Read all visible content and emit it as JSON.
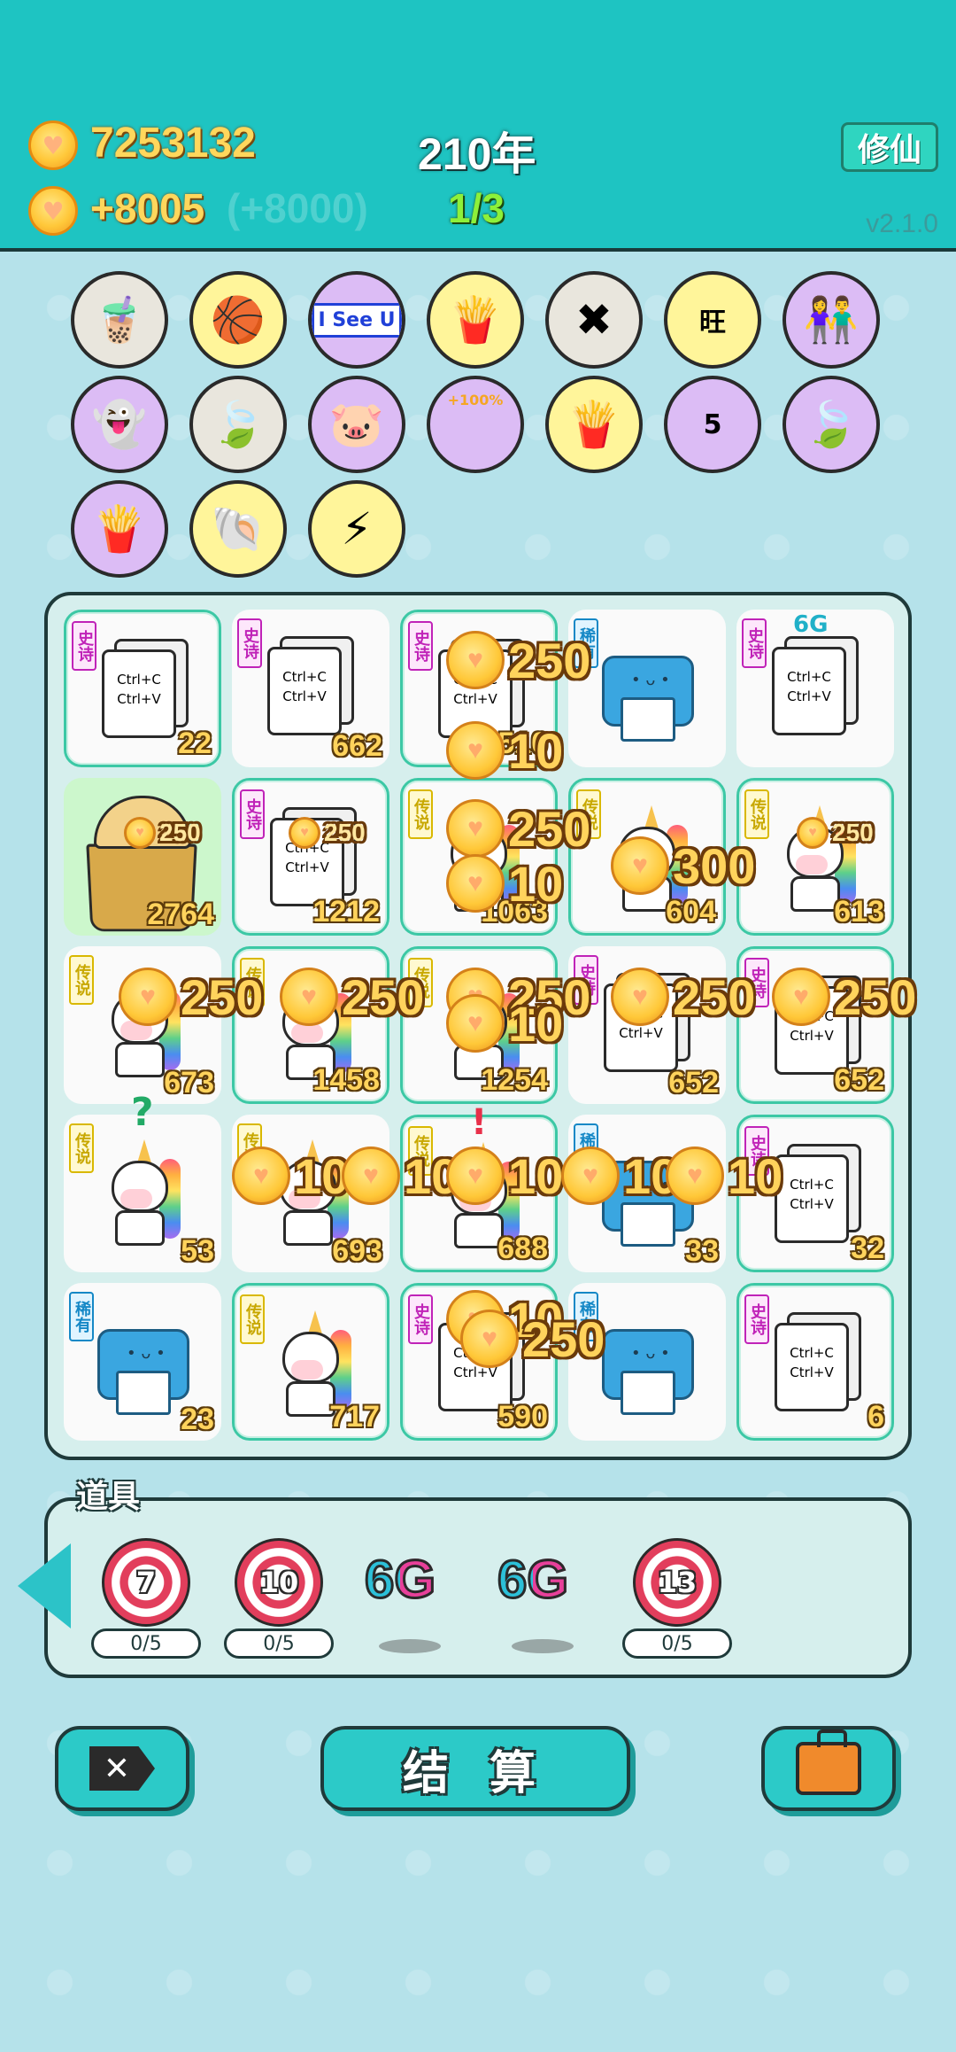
{
  "header": {
    "coins": "7253132",
    "income": "+8005",
    "income_base": "(+8000)",
    "year": "210年",
    "wave": "1/3",
    "cultivate_label": "修仙",
    "version": "v2.1.0"
  },
  "relics": [
    {
      "name": "bubble-tea-icon",
      "bg": "#e9e6dd",
      "label": ""
    },
    {
      "name": "basketballs-icon",
      "bg": "#fff59a",
      "label": ""
    },
    {
      "name": "i-see-u-icon",
      "bg": "#dcbcf5",
      "label": "I See U"
    },
    {
      "name": "fries-icon",
      "bg": "#fff59a",
      "label": ""
    },
    {
      "name": "delete-tag-icon",
      "bg": "#e9e6dd",
      "label": ""
    },
    {
      "name": "wang-chars-icon",
      "bg": "#fff59a",
      "label": "旺"
    },
    {
      "name": "couple-icon",
      "bg": "#dcbcf5",
      "label": ""
    },
    {
      "name": "ghost-icon",
      "bg": "#dcbcf5",
      "label": ""
    },
    {
      "name": "leaf-icon",
      "bg": "#e9e6dd",
      "label": ""
    },
    {
      "name": "piggy-bank-icon",
      "bg": "#dcbcf5",
      "label": ""
    },
    {
      "name": "drink-plus-icon",
      "bg": "#dcbcf5",
      "label": "+100%"
    },
    {
      "name": "fries-icon",
      "bg": "#fff59a",
      "label": ""
    },
    {
      "name": "calendar-icon",
      "bg": "#dcbcf5",
      "label": "5"
    },
    {
      "name": "leaf-icon",
      "bg": "#dcbcf5",
      "label": ""
    },
    {
      "name": "fries-icon",
      "bg": "#dcbcf5",
      "label": ""
    },
    {
      "name": "shell-icon",
      "bg": "#fff59a",
      "label": ""
    },
    {
      "name": "lightning-icon",
      "bg": "#fff59a",
      "label": ""
    }
  ],
  "tags": {
    "epic": "史诗",
    "legend": "传说",
    "rare": "稀有"
  },
  "doc_text": {
    "line1": "Ctrl+C",
    "line2": "Ctrl+V"
  },
  "sixg": "6G",
  "board": [
    {
      "type": "doc",
      "tag": "epic",
      "num": "22",
      "edge": true
    },
    {
      "type": "doc",
      "tag": "epic",
      "num": "662",
      "edge": false
    },
    {
      "type": "doc",
      "tag": "epic",
      "num": "510",
      "edge": true
    },
    {
      "type": "printer",
      "tag": "rare",
      "num": "",
      "edge": false
    },
    {
      "type": "doc",
      "tag": "epic",
      "num": "",
      "edge": false,
      "sixg": true
    },
    {
      "type": "cup",
      "tag": "",
      "num": "2764",
      "edge": false
    },
    {
      "type": "doc",
      "tag": "epic",
      "num": "1212",
      "edge": true
    },
    {
      "type": "unicorn",
      "tag": "legend",
      "num": "1063",
      "edge": true
    },
    {
      "type": "unicorn",
      "tag": "legend",
      "num": "604",
      "edge": true
    },
    {
      "type": "unicorn",
      "tag": "legend",
      "num": "613",
      "edge": true
    },
    {
      "type": "unicorn",
      "tag": "legend",
      "num": "673",
      "edge": false
    },
    {
      "type": "unicorn",
      "tag": "legend",
      "num": "1458",
      "edge": true
    },
    {
      "type": "unicorn",
      "tag": "legend",
      "num": "1254",
      "edge": true
    },
    {
      "type": "doc",
      "tag": "epic",
      "num": "652",
      "edge": false
    },
    {
      "type": "doc",
      "tag": "epic",
      "num": "652",
      "edge": true
    },
    {
      "type": "unicorn",
      "tag": "legend",
      "num": "53",
      "edge": false
    },
    {
      "type": "unicorn",
      "tag": "legend",
      "num": "693",
      "edge": false
    },
    {
      "type": "unicorn",
      "tag": "legend",
      "num": "688",
      "edge": true
    },
    {
      "type": "printer",
      "tag": "rare",
      "num": "33",
      "edge": false
    },
    {
      "type": "doc",
      "tag": "epic",
      "num": "32",
      "edge": true
    },
    {
      "type": "printer",
      "tag": "rare",
      "num": "23",
      "edge": false
    },
    {
      "type": "unicorn",
      "tag": "legend",
      "num": "717",
      "edge": true
    },
    {
      "type": "doc",
      "tag": "epic",
      "num": "590",
      "edge": true
    },
    {
      "type": "printer",
      "tag": "rare",
      "num": "",
      "edge": false
    },
    {
      "type": "doc",
      "tag": "epic",
      "num": "6",
      "edge": true
    }
  ],
  "popups": [
    {
      "v": "250",
      "size": "big"
    },
    {
      "v": "10",
      "size": "big"
    },
    {
      "v": "250",
      "size": "small"
    },
    {
      "v": "250",
      "size": "small"
    },
    {
      "v": "250",
      "size": "big"
    },
    {
      "v": "10",
      "size": "big"
    },
    {
      "v": "300",
      "size": "big"
    },
    {
      "v": "250",
      "size": "small"
    },
    {
      "v": "250",
      "size": "big"
    },
    {
      "v": "250",
      "size": "big"
    },
    {
      "v": "250",
      "size": "big"
    },
    {
      "v": "10",
      "size": "big"
    },
    {
      "v": "250",
      "size": "big"
    },
    {
      "v": "250",
      "size": "big"
    },
    {
      "v": "10",
      "size": "big"
    },
    {
      "v": "10",
      "size": "big"
    },
    {
      "v": "10",
      "size": "big"
    },
    {
      "v": "10",
      "size": "big"
    },
    {
      "v": "10",
      "size": "big"
    },
    {
      "v": "10",
      "size": "big"
    },
    {
      "v": "250",
      "size": "big"
    }
  ],
  "props": {
    "title": "道具",
    "items": [
      {
        "kind": "target",
        "value": "7",
        "progress": "0/5"
      },
      {
        "kind": "target",
        "value": "10",
        "progress": "0/5"
      },
      {
        "kind": "sixg",
        "value": "6G",
        "progress": ""
      },
      {
        "kind": "sixg",
        "value": "6G",
        "progress": ""
      },
      {
        "kind": "target",
        "value": "13",
        "progress": "0/5"
      }
    ]
  },
  "buttons": {
    "settle": "结 算"
  },
  "unicorn_markers": {
    "question": "?",
    "exclaim": "!"
  }
}
